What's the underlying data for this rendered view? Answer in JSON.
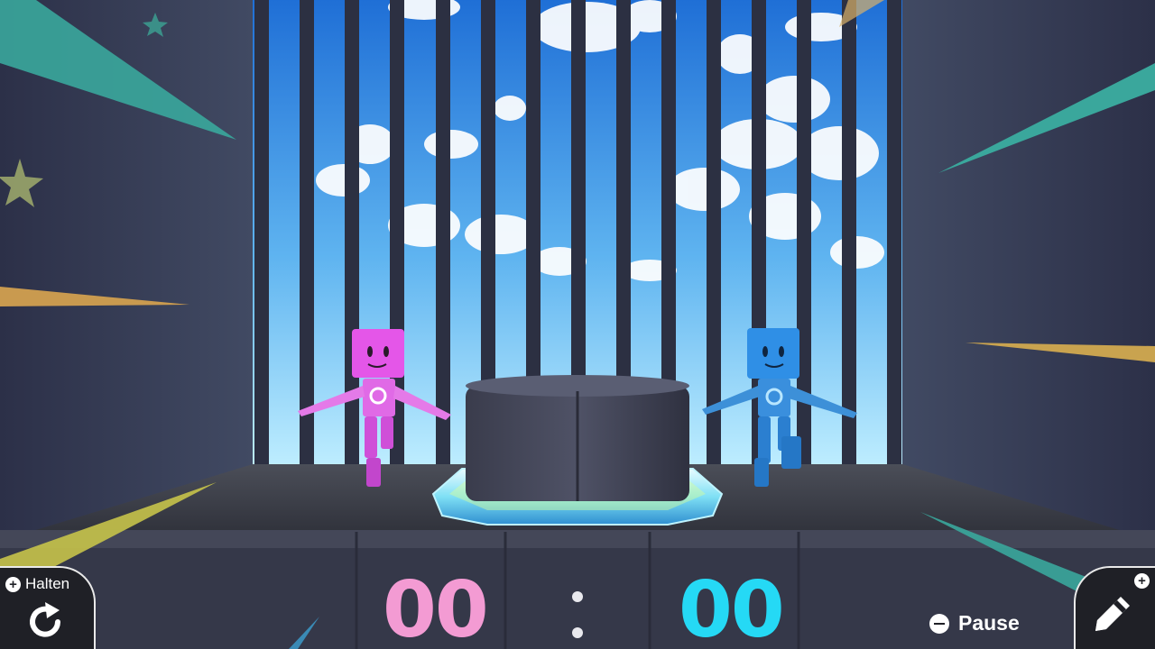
{
  "hud": {
    "hold_label": "Halten",
    "hold_badge": "+",
    "edit_badge": "+",
    "pause_label": "Pause",
    "score_left": "00",
    "score_right": "00"
  },
  "icons": {
    "hold": "rotate-arrow-icon",
    "edit": "pencil-icon",
    "pause_button": "minus-circle-icon",
    "hold_button": "plus-circle-icon"
  },
  "colors": {
    "player_pink": "#e456e8",
    "player_blue": "#2f8fe6",
    "score_pink": "#f39bd3",
    "score_blue": "#25d9f5",
    "platform_ring": "#7fe0f5"
  }
}
